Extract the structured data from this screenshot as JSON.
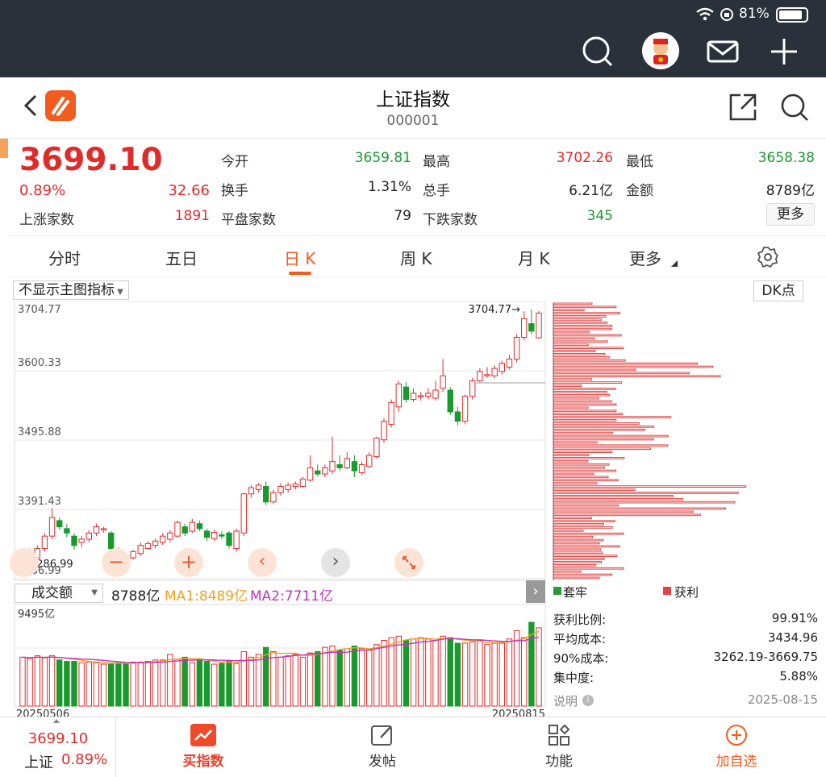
{
  "status": {
    "battery": "81%"
  },
  "header": {
    "title": "上证指数",
    "code": "000001"
  },
  "quote": {
    "price": "3699.10",
    "pct": "0.89%",
    "change": "32.66",
    "up_label": "上涨家数",
    "up_count": "1891",
    "open_label": "今开",
    "open": "3659.81",
    "high_label": "最高",
    "high": "3702.26",
    "low_label": "最低",
    "low": "3658.38",
    "turnover_label": "换手",
    "turnover": "1.31%",
    "vol_label": "总手",
    "vol": "6.21亿",
    "amount_label": "金额",
    "amount": "8789亿",
    "flat_label": "平盘家数",
    "flat_count": "79",
    "down_label": "下跌家数",
    "down_count": "345",
    "more": "更多"
  },
  "tabs": [
    "分时",
    "五日",
    "日 K",
    "周 K",
    "月 K",
    "更多"
  ],
  "active_tab": "日 K",
  "chart": {
    "indicator_select": "不显示主图指标",
    "dk_button": "DK点",
    "y_labels": [
      "3704.77",
      "3600.33",
      "3495.88",
      "3391.43",
      "3286.99"
    ],
    "max_marker": "3704.77→",
    "min_marker": "←3286.99",
    "vol_select": "成交额",
    "vol_value": "8788亿",
    "ma1": "MA1:8489亿",
    "ma2": "MA2:7711亿",
    "vol_max": "9495亿",
    "date_start": "20250506",
    "date_end": "20250815"
  },
  "chips": {
    "legend_trapped": "套牢",
    "legend_profit": "获利",
    "rows": [
      {
        "label": "获利比例:",
        "value": "99.91%"
      },
      {
        "label": "平均成本:",
        "value": "3434.96"
      },
      {
        "label": "90%成本:",
        "value": "3262.19-3669.75"
      },
      {
        "label": "集中度:",
        "value": "5.88%"
      }
    ],
    "note_label": "说明",
    "date": "2025-08-15"
  },
  "bottom": {
    "price": "3699.10",
    "name": "上证",
    "pct": "0.89%",
    "items": [
      "买指数",
      "发帖",
      "功能",
      "加自选"
    ]
  },
  "colors": {
    "up": "#e02b2b",
    "down": "#1a9a2e",
    "accent": "#f25c1f",
    "ma1": "#f0a020",
    "ma2": "#c034c0"
  },
  "chart_data": {
    "type": "candlestick",
    "ylim": [
      3286.99,
      3704.77
    ],
    "dates": [
      "20250506",
      "20250815"
    ],
    "candles": [
      [
        3290,
        3305,
        3282,
        3310
      ],
      [
        3300,
        3312,
        3296,
        3320
      ],
      [
        3305,
        3320,
        3300,
        3325
      ],
      [
        3320,
        3340,
        3315,
        3345
      ],
      [
        3340,
        3370,
        3335,
        3385
      ],
      [
        3365,
        3355,
        3350,
        3370
      ],
      [
        3352,
        3345,
        3338,
        3360
      ],
      [
        3340,
        3325,
        3318,
        3345
      ],
      [
        3330,
        3335,
        3322,
        3340
      ],
      [
        3335,
        3345,
        3330,
        3350
      ],
      [
        3345,
        3355,
        3340,
        3360
      ],
      [
        3350,
        3352,
        3345,
        3355
      ],
      [
        3345,
        3320,
        3312,
        3348
      ],
      [
        3318,
        3310,
        3305,
        3322
      ],
      [
        3308,
        3302,
        3298,
        3312
      ],
      [
        3305,
        3315,
        3302,
        3318
      ],
      [
        3312,
        3325,
        3308,
        3330
      ],
      [
        3320,
        3328,
        3318,
        3332
      ],
      [
        3325,
        3332,
        3320,
        3336
      ],
      [
        3330,
        3340,
        3326,
        3345
      ],
      [
        3335,
        3345,
        3330,
        3350
      ],
      [
        3340,
        3362,
        3338,
        3365
      ],
      [
        3355,
        3345,
        3340,
        3360
      ],
      [
        3348,
        3362,
        3345,
        3368
      ],
      [
        3360,
        3352,
        3348,
        3365
      ],
      [
        3348,
        3338,
        3332,
        3352
      ],
      [
        3336,
        3346,
        3332,
        3350
      ],
      [
        3342,
        3340,
        3335,
        3348
      ],
      [
        3345,
        3325,
        3320,
        3348
      ],
      [
        3320,
        3348,
        3315,
        3352
      ],
      [
        3345,
        3408,
        3340,
        3410
      ],
      [
        3408,
        3418,
        3402,
        3422
      ],
      [
        3415,
        3422,
        3410,
        3425
      ],
      [
        3420,
        3395,
        3390,
        3428
      ],
      [
        3395,
        3410,
        3392,
        3415
      ],
      [
        3410,
        3420,
        3405,
        3425
      ],
      [
        3415,
        3422,
        3410,
        3426
      ],
      [
        3420,
        3424,
        3415,
        3428
      ],
      [
        3420,
        3432,
        3418,
        3435
      ],
      [
        3430,
        3450,
        3428,
        3470
      ],
      [
        3445,
        3440,
        3436,
        3455
      ],
      [
        3440,
        3450,
        3435,
        3455
      ],
      [
        3445,
        3460,
        3440,
        3500
      ],
      [
        3455,
        3450,
        3445,
        3470
      ],
      [
        3450,
        3465,
        3448,
        3475
      ],
      [
        3460,
        3445,
        3435,
        3470
      ],
      [
        3442,
        3455,
        3438,
        3460
      ],
      [
        3452,
        3470,
        3450,
        3475
      ],
      [
        3468,
        3498,
        3465,
        3500
      ],
      [
        3495,
        3525,
        3490,
        3530
      ],
      [
        3520,
        3555,
        3515,
        3560
      ],
      [
        3548,
        3585,
        3540,
        3590
      ],
      [
        3580,
        3560,
        3555,
        3588
      ],
      [
        3560,
        3570,
        3556,
        3578
      ],
      [
        3565,
        3566,
        3558,
        3572
      ],
      [
        3565,
        3570,
        3560,
        3578
      ],
      [
        3562,
        3575,
        3558,
        3590
      ],
      [
        3578,
        3598,
        3572,
        3625
      ],
      [
        3575,
        3540,
        3535,
        3580
      ],
      [
        3540,
        3525,
        3518,
        3548
      ],
      [
        3525,
        3565,
        3520,
        3568
      ],
      [
        3565,
        3590,
        3560,
        3595
      ],
      [
        3590,
        3605,
        3585,
        3610
      ],
      [
        3600,
        3600,
        3595,
        3612
      ],
      [
        3598,
        3610,
        3594,
        3615
      ],
      [
        3605,
        3618,
        3600,
        3622
      ],
      [
        3612,
        3625,
        3608,
        3632
      ],
      [
        3625,
        3660,
        3620,
        3665
      ],
      [
        3660,
        3690,
        3655,
        3702
      ],
      [
        3682,
        3670,
        3665,
        3705
      ],
      [
        3659,
        3699,
        3658,
        3702
      ]
    ],
    "volume_ratio": [
      0.7,
      0.68,
      0.72,
      0.69,
      0.72,
      0.66,
      0.64,
      0.64,
      0.62,
      0.63,
      0.62,
      0.6,
      0.6,
      0.62,
      0.62,
      0.63,
      0.63,
      0.64,
      0.66,
      0.66,
      0.74,
      0.67,
      0.7,
      0.62,
      0.66,
      0.64,
      0.6,
      0.61,
      0.64,
      0.61,
      0.78,
      0.7,
      0.74,
      0.84,
      0.78,
      0.7,
      0.72,
      0.74,
      0.7,
      0.76,
      0.78,
      0.84,
      0.86,
      0.8,
      0.82,
      0.86,
      0.82,
      0.8,
      0.88,
      0.94,
      0.98,
      1.0,
      0.94,
      0.96,
      0.98,
      0.96,
      0.94,
      1.0,
      0.98,
      0.9,
      0.9,
      0.92,
      0.94,
      0.88,
      0.9,
      0.9,
      0.96,
      1.08,
      0.98,
      1.2,
      1.12
    ]
  }
}
